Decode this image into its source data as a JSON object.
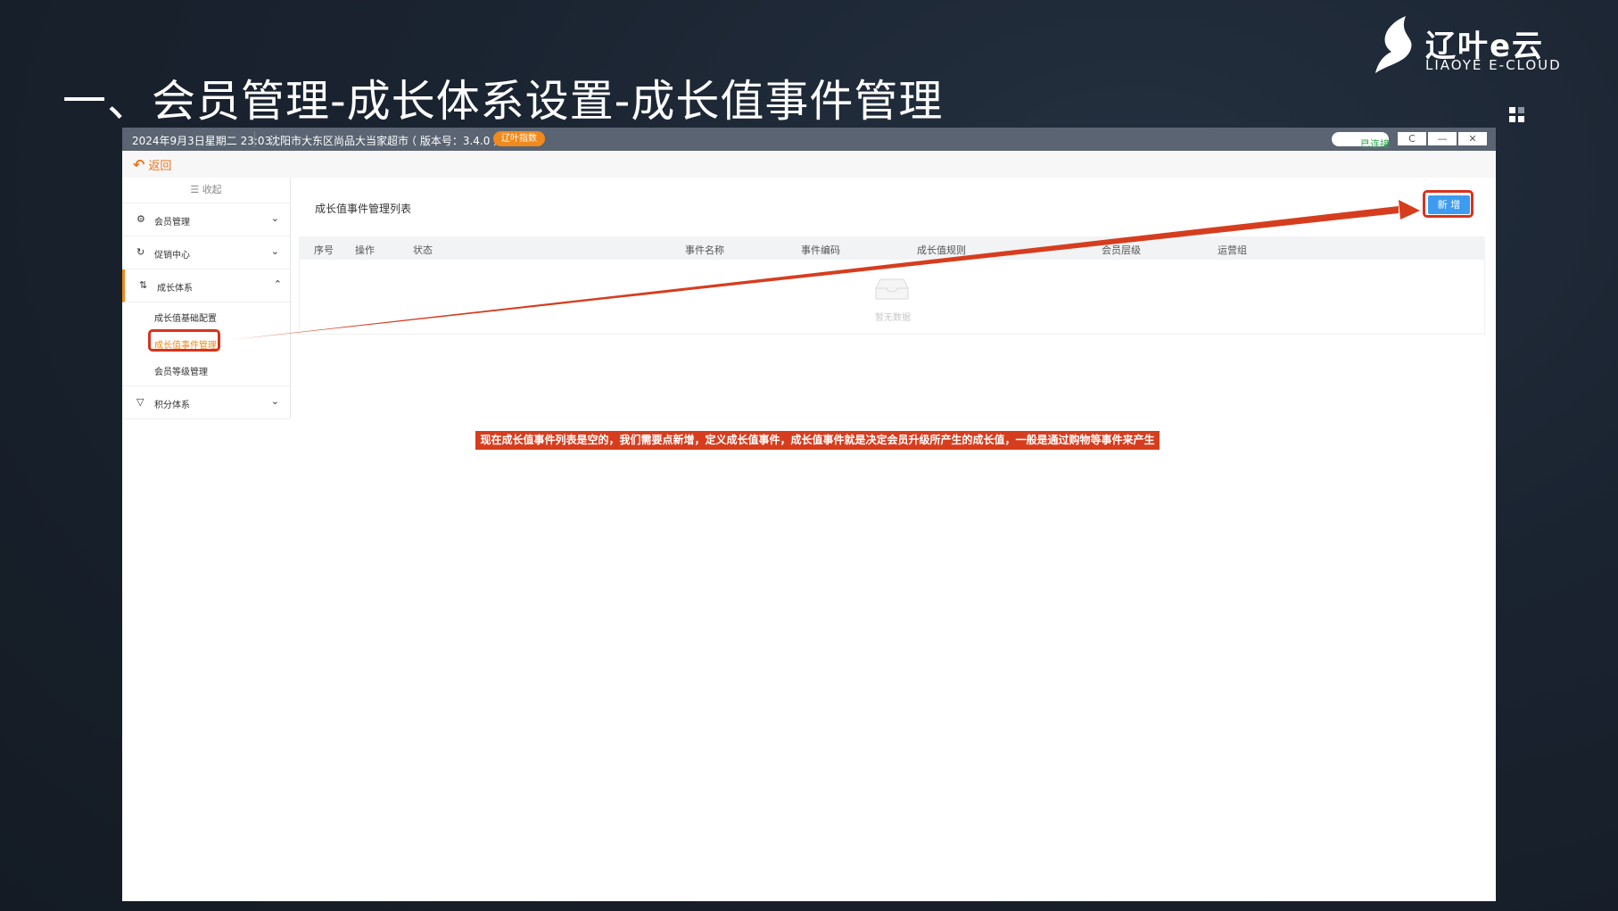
{
  "slide": {
    "title": "一、会员管理-成长体系设置-成长值事件管理",
    "logo_cn": "辽叶e云",
    "logo_en": "LIAOYE E-CLOUD"
  },
  "titlebar": {
    "datetime": "2024年9月3日星期二 23:03",
    "store": "沈阳市大东区尚品大当家超市",
    "version": "（ 版本号：3.4.0 ）",
    "badge": "辽叶指数",
    "connection": "已连接",
    "refresh": "C",
    "minimize": "—",
    "close": "✕"
  },
  "back": {
    "label": "返回"
  },
  "sidebar": {
    "collapse": "收起",
    "items": [
      {
        "label": "会员管理"
      },
      {
        "label": "促销中心"
      },
      {
        "label": "成长体系"
      },
      {
        "label": "积分体系"
      }
    ],
    "sub_items": [
      {
        "label": "成长值基础配置"
      },
      {
        "label": "成长值事件管理"
      },
      {
        "label": "会员等级管理"
      }
    ]
  },
  "main": {
    "list_title": "成长值事件管理列表",
    "add_button": "新 增",
    "columns": [
      "序号",
      "操作",
      "状态",
      "事件名称",
      "事件编码",
      "成长值规则",
      "会员层级",
      "运营组"
    ],
    "empty_text": "暂无数据"
  },
  "annotation": {
    "note": "现在成长值事件列表是空的，我们需要点新增，定义成长值事件，成长值事件就是决定会员升级所产生的成长值，一般是通过购物等事件来产生"
  },
  "colors": {
    "accent": "#f08a1c",
    "primary": "#3d9cf0",
    "annotation_red": "#d63d1e"
  }
}
